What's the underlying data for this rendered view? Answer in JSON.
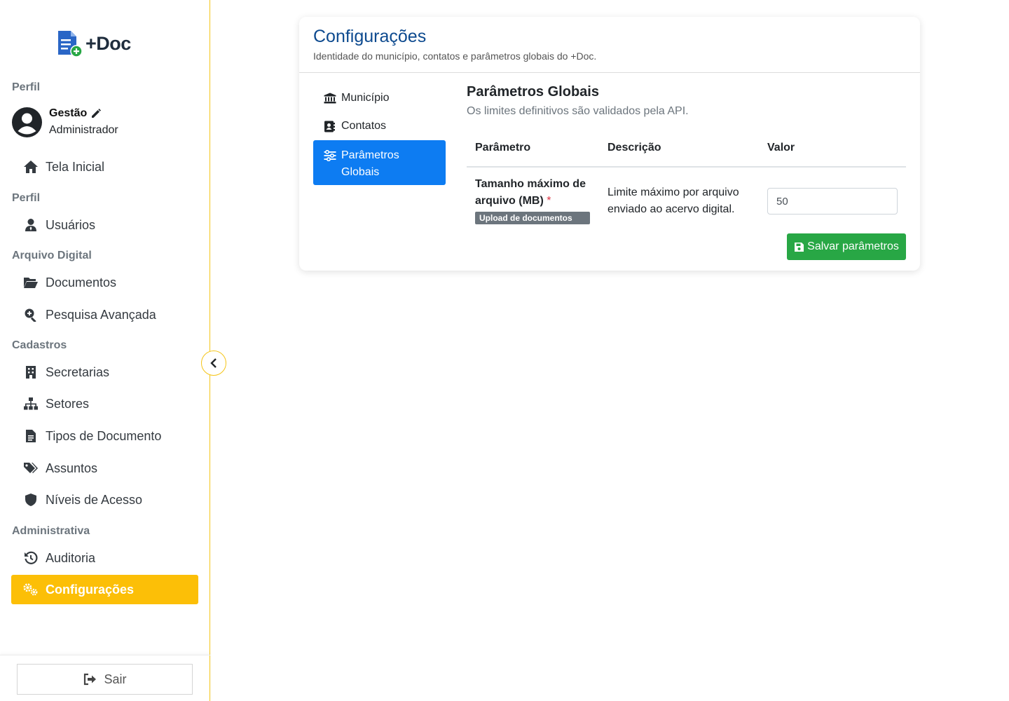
{
  "brand": {
    "name": "+Doc"
  },
  "profile": {
    "section": "Perfil",
    "name": "Gestão",
    "role": "Administrador"
  },
  "nav": {
    "home": "Tela Inicial",
    "section_profile": "Perfil",
    "users": "Usuários",
    "section_archive": "Arquivo Digital",
    "documents": "Documentos",
    "advanced_search": "Pesquisa Avançada",
    "section_registers": "Cadastros",
    "secretariats": "Secretarias",
    "sectors": "Setores",
    "doc_types": "Tipos de Documento",
    "subjects": "Assuntos",
    "access_levels": "Níveis de Acesso",
    "section_admin": "Administrativa",
    "audit": "Auditoria",
    "settings": "Configurações"
  },
  "logout": "Sair",
  "page": {
    "title": "Configurações",
    "subtitle": "Identidade do município, contatos e parâmetros globais do +Doc."
  },
  "tabs": [
    {
      "label": "Município",
      "icon": "landmark-icon"
    },
    {
      "label": "Contatos",
      "icon": "address-book-icon"
    },
    {
      "label": "Parâmetros Globais",
      "icon": "sliders-icon"
    }
  ],
  "pane": {
    "title": "Parâmetros Globais",
    "subtitle": "Os limites definitivos são validados pela API."
  },
  "table": {
    "headers": [
      "Parâmetro",
      "Descrição",
      "Valor"
    ],
    "rows": [
      {
        "name": "Tamanho máximo de arquivo (MB)",
        "required": "*",
        "badge": "Upload de documentos",
        "description": "Limite máximo por arquivo enviado ao acervo digital.",
        "value": "50"
      }
    ]
  },
  "save_label": "Salvar parâmetros",
  "colors": {
    "accent": "#fcbf07",
    "primary": "#0d7cf2",
    "success": "#28a745",
    "title": "#0d4a8f"
  }
}
